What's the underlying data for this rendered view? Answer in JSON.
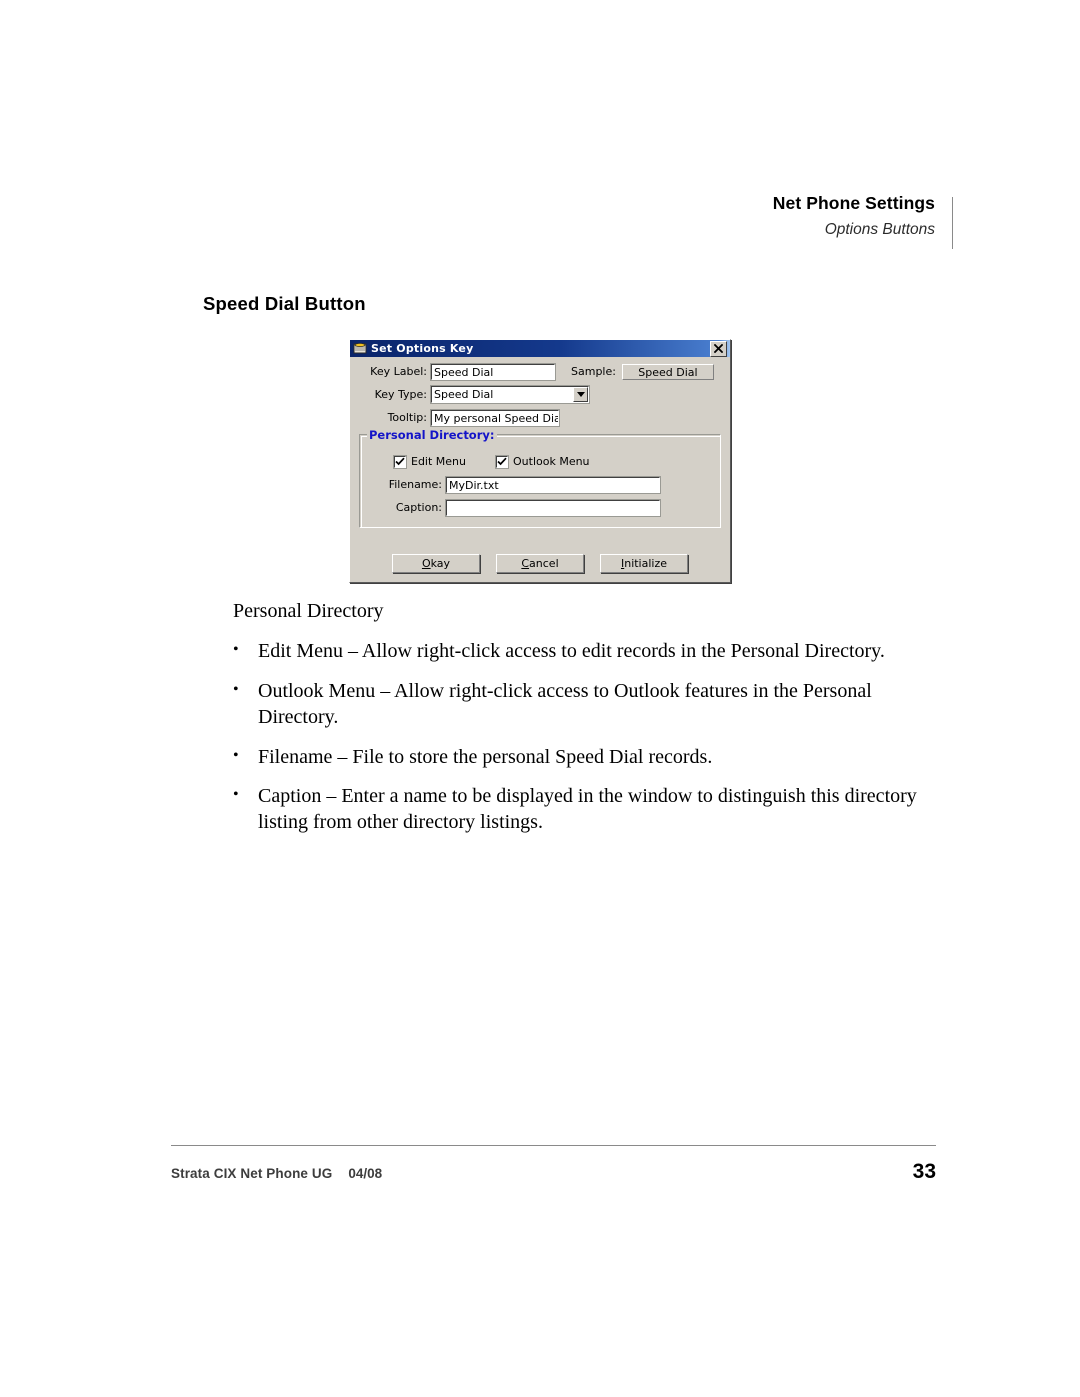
{
  "header": {
    "title": "Net Phone Settings",
    "subtitle": "Options Buttons"
  },
  "section": {
    "heading": "Speed Dial Button"
  },
  "dialog": {
    "title": "Set Options Key",
    "icon": "phone-icon",
    "close_label": "×",
    "fields": {
      "key_label": {
        "label": "Key Label:",
        "value": "Speed Dial"
      },
      "sample": {
        "label": "Sample:",
        "button_value": "Speed Dial"
      },
      "key_type": {
        "label": "Key Type:",
        "value": "Speed Dial"
      },
      "tooltip": {
        "label": "Tooltip:",
        "value": "My personal Speed Dia"
      }
    },
    "group": {
      "legend": "Personal Directory:",
      "legend_color": "#1414c8",
      "checkboxes": [
        {
          "label": "Edit Menu",
          "checked": true
        },
        {
          "label": "Outlook Menu",
          "checked": true
        }
      ],
      "filename": {
        "label": "Filename:",
        "value": "MyDir.txt"
      },
      "caption": {
        "label": "Caption:",
        "value": ""
      }
    },
    "buttons": [
      {
        "accel": "O",
        "rest": "kay"
      },
      {
        "accel": "C",
        "rest": "ancel"
      },
      {
        "accel": "I",
        "rest": "nitialize"
      }
    ],
    "colors": {
      "face": "#d4d0c8",
      "titlebar_start": "#0a246a",
      "titlebar_end": "#a6c8f0"
    }
  },
  "body": {
    "lead": "Personal Directory",
    "bullets": [
      "Edit Menu – Allow right-click access to edit records in the Personal Directory.",
      "Outlook Menu – Allow right-click access to Outlook features in the Personal Directory.",
      "Filename – File to store the personal Speed Dial records.",
      "Caption – Enter a name to be displayed in the window to distinguish this directory listing from other directory listings."
    ],
    "bullet_glyph": "•"
  },
  "footer": {
    "document": "Strata CIX Net Phone UG",
    "date": "04/08",
    "page_number": "33"
  }
}
